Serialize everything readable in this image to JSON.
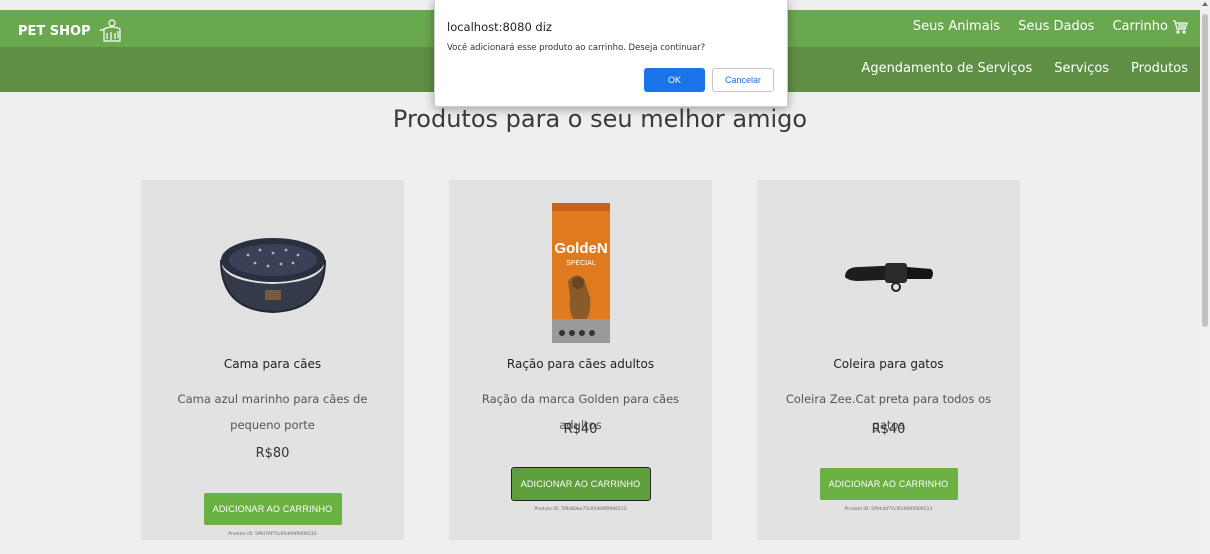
{
  "header": {
    "brand": "PET SHOP",
    "brand_icon": "pet-grooming-icon",
    "top_nav": [
      "Seus Animais",
      "Seus Dados",
      "Carrinho"
    ],
    "cart_icon": "shopping-cart-icon",
    "sub_nav": [
      "Agendamento de Serviços",
      "Serviços",
      "Produtos"
    ],
    "colors": {
      "top": "#6aa84f",
      "sub": "#5f8f45"
    }
  },
  "main": {
    "title": "Produtos para o seu melhor amigo",
    "products": [
      {
        "image": "pet-bed-image",
        "name": "Cama para cães",
        "description": "Cama azul marinho para cães de pequeno porte",
        "price": "R$80",
        "button": "ADICIONAR AO CARRINHO",
        "product_id": "Produto ID: 5f9d76f75c95d09f0906510"
      },
      {
        "image": "dog-food-bag-image",
        "name": "Ração para cães adultos",
        "description": "Ração da marca Golden para cães adultos",
        "price": "R$40",
        "button": "ADICIONAR AO CARRINHO",
        "product_id": "Produto ID: 5f9d80be75c95d09f0906512",
        "bag_text": {
          "brand": "GoldeN",
          "line": "SPECIAL"
        }
      },
      {
        "image": "cat-collar-image",
        "name": "Coleira para gatos",
        "description": "Coleira Zee.Cat preta para todos os gatos",
        "price": "R$40",
        "button": "ADICIONAR AO CARRINHO",
        "product_id": "Produto ID: 5f9dcbf75c95d09f0906513"
      }
    ]
  },
  "dialog": {
    "origin": "localhost:8080 diz",
    "message": "Você adicionará esse produto ao carrinho. Deseja continuar?",
    "ok": "OK",
    "cancel": "Cancelar",
    "accent": "#1a73e8"
  }
}
